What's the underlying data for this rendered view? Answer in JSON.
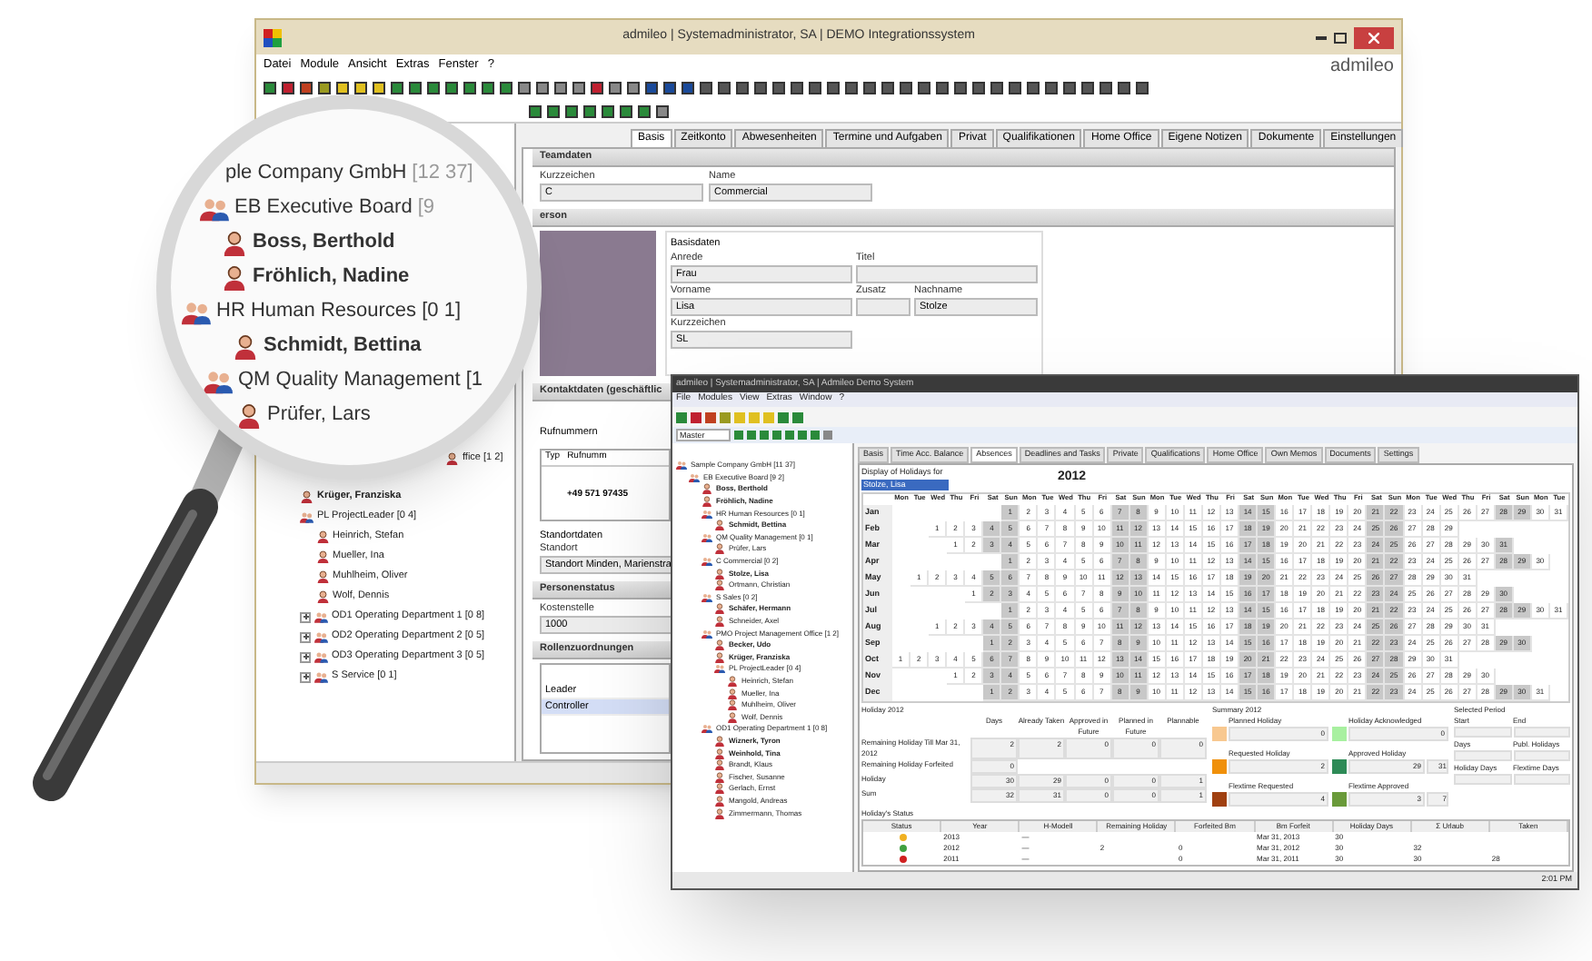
{
  "main_window": {
    "title": "admileo | Systemadministrator, SA | DEMO Integrationssystem",
    "logo": "admileo",
    "menu": [
      "Datei",
      "Module",
      "Ansicht",
      "Extras",
      "Fenster",
      "?"
    ],
    "tree": [
      {
        "label": "ffice [1 2]",
        "bold": false
      },
      {
        "label": "Krüger, Franziska",
        "bold": true
      },
      {
        "label": "PL ProjectLeader [0 4]",
        "bold": false,
        "children": [
          {
            "label": "Heinrich, Stefan",
            "bold": false
          },
          {
            "label": "Mueller, Ina",
            "bold": false
          },
          {
            "label": "Muhlheim, Oliver",
            "bold": false
          },
          {
            "label": "Wolf, Dennis",
            "bold": false
          }
        ]
      },
      {
        "label": "OD1 Operating Department 1 [0 8]",
        "bold": false,
        "collapsed": true
      },
      {
        "label": "OD2 Operating Department 2 [0 5]",
        "bold": false,
        "collapsed": true
      },
      {
        "label": "OD3 Operating Department 3 [0 5]",
        "bold": false,
        "collapsed": true
      },
      {
        "label": "S Service [0 1]",
        "bold": false,
        "collapsed": true
      }
    ],
    "tabs": [
      {
        "label": "Basis",
        "selected": true
      },
      {
        "label": "Zeitkonto",
        "selected": false
      },
      {
        "label": "Abwesenheiten",
        "selected": false
      },
      {
        "label": "Termine und Aufgaben",
        "selected": false
      },
      {
        "label": "Privat",
        "selected": false
      },
      {
        "label": "Qualifikationen",
        "selected": false
      },
      {
        "label": "Home Office",
        "selected": false
      },
      {
        "label": "Eigene Notizen",
        "selected": false
      },
      {
        "label": "Dokumente",
        "selected": false
      },
      {
        "label": "Einstellungen",
        "selected": false
      }
    ],
    "teamdaten": {
      "title": "Teamdaten",
      "fields": [
        {
          "label": "Kurzzeichen",
          "value": "C"
        },
        {
          "label": "Name",
          "value": "Commercial"
        }
      ]
    },
    "person": {
      "title": "erson",
      "group": "Basisdaten",
      "anrede": {
        "label": "Anrede",
        "value": "Frau"
      },
      "titel": {
        "label": "Titel"
      },
      "vorname": {
        "label": "Vorname",
        "value": "Lisa"
      },
      "zusatz": {
        "label": "Zusatz"
      },
      "nachname": {
        "label": "Nachname",
        "value": "Stolze"
      },
      "kurzzeichen": {
        "label": "Kurzzeichen",
        "value": "SL"
      }
    },
    "kontakt": {
      "title": "Kontaktdaten (geschäftlic",
      "rufnummern": "Rufnummern",
      "columns": [
        "Typ",
        "Rufnumm"
      ],
      "number": "+49 571 97435",
      "standortdaten": "Standortdaten",
      "standort_label": "Standort",
      "standort": "Standort Minden, Marienstra"
    },
    "personenstatus": {
      "title": "Personenstatus",
      "label": "Kostenstelle",
      "value": "1000"
    },
    "rollen": {
      "title": "Rollenzuordnungen",
      "items": [
        {
          "label": "Leader",
          "selected": false
        },
        {
          "label": "Controller",
          "selected": true
        }
      ]
    }
  },
  "lens": {
    "items": [
      {
        "label": "ple Company GmbH",
        "count": "[12 37]",
        "kind": "company",
        "bold": false
      },
      {
        "label": "EB Executive Board",
        "count": "[9",
        "kind": "group",
        "bold": false
      },
      {
        "label": "Boss, Berthold",
        "kind": "person",
        "bold": true
      },
      {
        "label": "Fröhlich, Nadine",
        "kind": "person",
        "bold": true
      },
      {
        "label": "HR Human Resources [0 1]",
        "kind": "group",
        "bold": false
      },
      {
        "label": "Schmidt, Bettina",
        "kind": "person",
        "bold": true
      },
      {
        "label": "QM Quality Management [1",
        "kind": "group",
        "bold": false
      },
      {
        "label": "Prüfer, Lars",
        "kind": "person",
        "bold": false
      }
    ]
  },
  "second_window": {
    "title": "admileo | Systemadministrator, SA | Admileo Demo System",
    "menu": [
      "File",
      "Modules",
      "View",
      "Extras",
      "Window",
      "?"
    ],
    "search": "Master",
    "tree": [
      {
        "label": "Sample Company GmbH [11 37]",
        "bold": false,
        "children": [
          {
            "label": "EB Executive Board [9 2]",
            "bold": false,
            "children": [
              {
                "label": "Boss, Berthold",
                "bold": true
              },
              {
                "label": "Fröhlich, Nadine",
                "bold": true
              },
              {
                "label": "HR Human Resources [0 1]",
                "bold": false,
                "children": [
                  {
                    "label": "Schmidt, Bettina",
                    "bold": true
                  }
                ]
              },
              {
                "label": "QM Quality Management [0 1]",
                "bold": false,
                "children": [
                  {
                    "label": "Prüfer, Lars",
                    "bold": false
                  }
                ]
              },
              {
                "label": "C Commercial [0 2]",
                "bold": false,
                "children": [
                  {
                    "label": "Stolze, Lisa",
                    "bold": true
                  },
                  {
                    "label": "Ortmann, Christian",
                    "bold": false
                  }
                ]
              },
              {
                "label": "S Sales [0 2]",
                "bold": false,
                "children": [
                  {
                    "label": "Schäfer, Hermann",
                    "bold": true
                  },
                  {
                    "label": "Schneider, Axel",
                    "bold": false
                  }
                ]
              },
              {
                "label": "PMO Project Management Office [1 2]",
                "bold": false,
                "children": [
                  {
                    "label": "Becker, Udo",
                    "bold": true
                  },
                  {
                    "label": "Krüger, Franziska",
                    "bold": true
                  },
                  {
                    "label": "PL ProjectLeader [0 4]",
                    "bold": false,
                    "children": [
                      {
                        "label": "Heinrich, Stefan",
                        "bold": false
                      },
                      {
                        "label": "Mueller, Ina",
                        "bold": false
                      },
                      {
                        "label": "Muhlheim, Oliver",
                        "bold": false
                      },
                      {
                        "label": "Wolf, Dennis",
                        "bold": false
                      }
                    ]
                  }
                ]
              },
              {
                "label": "OD1 Operating Department 1 [0 8]",
                "bold": false,
                "children": [
                  {
                    "label": "Wiznerk, Tyron",
                    "bold": true
                  },
                  {
                    "label": "Weinhold, Tina",
                    "bold": true
                  },
                  {
                    "label": "Brandt, Klaus",
                    "bold": false
                  },
                  {
                    "label": "Fischer, Susanne",
                    "bold": false
                  },
                  {
                    "label": "Gerlach, Ernst",
                    "bold": false
                  },
                  {
                    "label": "Mangold, Andreas",
                    "bold": false
                  },
                  {
                    "label": "Zimmermann, Thomas",
                    "bold": false
                  }
                ]
              }
            ]
          }
        ]
      }
    ],
    "tabs": [
      {
        "label": "Basis",
        "selected": false
      },
      {
        "label": "Time Acc. Balance",
        "selected": false
      },
      {
        "label": "Absences",
        "selected": true
      },
      {
        "label": "Deadlines and Tasks",
        "selected": false
      },
      {
        "label": "Private",
        "selected": false
      },
      {
        "label": "Qualifications",
        "selected": false
      },
      {
        "label": "Home Office",
        "selected": false
      },
      {
        "label": "Own Memos",
        "selected": false
      },
      {
        "label": "Documents",
        "selected": false
      },
      {
        "label": "Settings",
        "selected": false
      }
    ],
    "display_label": "Display of Holidays for",
    "display_value": "Stolze, Lisa",
    "year": "2012",
    "weekdays": [
      "Mon",
      "Tue",
      "Wed",
      "Thu",
      "Fri",
      "Sat",
      "Sun",
      "Mon",
      "Tue",
      "Wed",
      "Thu",
      "Fri",
      "Sat",
      "Sun",
      "Mon",
      "Tue",
      "Wed",
      "Thu",
      "Fri",
      "Sat",
      "Sun",
      "Mon",
      "Tue",
      "Wed",
      "Thu",
      "Fri",
      "Sat",
      "Sun",
      "Mon",
      "Tue",
      "Wed",
      "Thu",
      "Fri",
      "Sat",
      "Sun",
      "Mon",
      "Tue"
    ],
    "months": [
      {
        "label": "Jan",
        "days": [
          "1",
          "2",
          "3",
          "4",
          "5",
          "6",
          "7",
          "8",
          "9",
          "10",
          "11",
          "12",
          "13",
          "14",
          "15",
          "16",
          "17",
          "18",
          "19",
          "20",
          "21",
          "22",
          "23",
          "24",
          "25",
          "26",
          "27",
          "28",
          "29",
          "30",
          "31"
        ]
      },
      {
        "label": "Feb",
        "days": [
          "1",
          "2",
          "3",
          "4",
          "5",
          "6",
          "7",
          "8",
          "9",
          "10",
          "11",
          "12",
          "13",
          "14",
          "15",
          "16",
          "17",
          "18",
          "19",
          "20",
          "21",
          "22",
          "23",
          "24",
          "25",
          "26",
          "27",
          "28",
          "29"
        ]
      },
      {
        "label": "Mar",
        "days": [
          "1",
          "2",
          "3",
          "4",
          "5",
          "6",
          "7",
          "8",
          "9",
          "10",
          "11",
          "12",
          "13",
          "14",
          "15",
          "16",
          "17",
          "18",
          "19",
          "20",
          "21",
          "22",
          "23",
          "24",
          "25",
          "26",
          "27",
          "28",
          "29",
          "30",
          "31"
        ]
      },
      {
        "label": "Apr",
        "days": [
          "1",
          "2",
          "3",
          "4",
          "5",
          "6",
          "7",
          "8",
          "9",
          "10",
          "11",
          "12",
          "13",
          "14",
          "15",
          "16",
          "17",
          "18",
          "19",
          "20",
          "21",
          "22",
          "23",
          "24",
          "25",
          "26",
          "27",
          "28",
          "29",
          "30"
        ]
      },
      {
        "label": "May",
        "days": [
          "1",
          "2",
          "3",
          "4",
          "5",
          "6",
          "7",
          "8",
          "9",
          "10",
          "11",
          "12",
          "13",
          "14",
          "15",
          "16",
          "17",
          "18",
          "19",
          "20",
          "21",
          "22",
          "23",
          "24",
          "25",
          "26",
          "27",
          "28",
          "29",
          "30",
          "31"
        ]
      },
      {
        "label": "Jun",
        "days": [
          "1",
          "2",
          "3",
          "4",
          "5",
          "6",
          "7",
          "8",
          "9",
          "10",
          "11",
          "12",
          "13",
          "14",
          "15",
          "16",
          "17",
          "18",
          "19",
          "20",
          "21",
          "22",
          "23",
          "24",
          "25",
          "26",
          "27",
          "28",
          "29",
          "30"
        ]
      },
      {
        "label": "Jul",
        "days": [
          "1",
          "2",
          "3",
          "4",
          "5",
          "6",
          "7",
          "8",
          "9",
          "10",
          "11",
          "12",
          "13",
          "14",
          "15",
          "16",
          "17",
          "18",
          "19",
          "20",
          "21",
          "22",
          "23",
          "24",
          "25",
          "26",
          "27",
          "28",
          "29",
          "30",
          "31"
        ]
      },
      {
        "label": "Aug",
        "days": [
          "1",
          "2",
          "3",
          "4",
          "5",
          "6",
          "7",
          "8",
          "9",
          "10",
          "11",
          "12",
          "13",
          "14",
          "15",
          "16",
          "17",
          "18",
          "19",
          "20",
          "21",
          "22",
          "23",
          "24",
          "25",
          "26",
          "27",
          "28",
          "29",
          "30",
          "31"
        ]
      },
      {
        "label": "Sep",
        "days": [
          "1",
          "2",
          "3",
          "4",
          "5",
          "6",
          "7",
          "8",
          "9",
          "10",
          "11",
          "12",
          "13",
          "14",
          "15",
          "16",
          "17",
          "18",
          "19",
          "20",
          "21",
          "22",
          "23",
          "24",
          "25",
          "26",
          "27",
          "28",
          "29",
          "30"
        ]
      },
      {
        "label": "Oct",
        "days": [
          "1",
          "2",
          "3",
          "4",
          "5",
          "6",
          "7",
          "8",
          "9",
          "10",
          "11",
          "12",
          "13",
          "14",
          "15",
          "16",
          "17",
          "18",
          "19",
          "20",
          "21",
          "22",
          "23",
          "24",
          "25",
          "26",
          "27",
          "28",
          "29",
          "30",
          "31"
        ]
      },
      {
        "label": "Nov",
        "days": [
          "1",
          "2",
          "3",
          "4",
          "5",
          "6",
          "7",
          "8",
          "9",
          "10",
          "11",
          "12",
          "13",
          "14",
          "15",
          "16",
          "17",
          "18",
          "19",
          "20",
          "21",
          "22",
          "23",
          "24",
          "25",
          "26",
          "27",
          "28",
          "29",
          "30"
        ]
      },
      {
        "label": "Dec",
        "days": [
          "1",
          "2",
          "3",
          "4",
          "5",
          "6",
          "7",
          "8",
          "9",
          "10",
          "11",
          "12",
          "13",
          "14",
          "15",
          "16",
          "17",
          "18",
          "19",
          "20",
          "21",
          "22",
          "23",
          "24",
          "25",
          "26",
          "27",
          "28",
          "29",
          "30",
          "31"
        ]
      }
    ],
    "holiday": {
      "title": "Holiday 2012",
      "columns": [
        "Days",
        "Already Taken",
        "Approved in Future",
        "Planned in Future",
        "Plannable"
      ],
      "rows": [
        {
          "label": "Remaining Holiday Till Mar 31, 2012",
          "values": [
            "2",
            "2",
            "0",
            "0",
            "0"
          ]
        },
        {
          "label": "Remaining Holiday Forfeited",
          "values": [
            "0"
          ]
        },
        {
          "label": "Holiday",
          "values": [
            "30",
            "29",
            "0",
            "0",
            "1"
          ]
        },
        {
          "label": "Sum",
          "values": [
            "32",
            "31",
            "0",
            "0",
            "1"
          ]
        }
      ]
    },
    "summary": {
      "title": "Summary 2012",
      "items": [
        {
          "label": "Planned Holiday",
          "value": "0",
          "color": "#f8c890"
        },
        {
          "label": "Holiday Acknowledged",
          "value": "0",
          "color": "#a8f0a0"
        },
        {
          "label": "Requested Holiday",
          "value": "2",
          "color": "#f0900a"
        },
        {
          "label": "Approved Holiday",
          "value": "29",
          "color": "#2e8b57",
          "sum": "31"
        },
        {
          "label": "Flextime Requested",
          "value": "4",
          "color": "#a04010"
        },
        {
          "label": "Flextime Approved",
          "value": "3",
          "color": "#6a9a3a",
          "sum": "7"
        }
      ]
    },
    "period": {
      "title": "Selected Period",
      "fields": [
        "Start",
        "End",
        "Days",
        "Publ. Holidays",
        "Holiday Days",
        "Flextime Days"
      ]
    },
    "status": {
      "title": "Holiday's Status",
      "columns": [
        "Status",
        "Year",
        "H-Modell",
        "Remaining Holiday",
        "Forfeited Bm",
        "Bm Forfeit",
        "Holiday Days",
        "Σ Urlaub",
        "Taken"
      ],
      "rows": [
        {
          "color": "#f0b020",
          "year": "2013",
          "h_modell": "—",
          "bm_forfeit": "Mar 31, 2013",
          "holiday_days": "30"
        },
        {
          "color": "#40a040",
          "year": "2012",
          "h_modell": "—",
          "remaining": "2",
          "forfeited": "0",
          "bm_forfeit": "Mar 31, 2012",
          "holiday_days": "30",
          "sum": "32"
        },
        {
          "color": "#d02020",
          "year": "2011",
          "h_modell": "—",
          "forfeited": "0",
          "bm_forfeit": "Mar 31, 2011",
          "holiday_days": "30",
          "sum": "30",
          "taken": "28"
        }
      ]
    },
    "clock": "2:01 PM"
  }
}
